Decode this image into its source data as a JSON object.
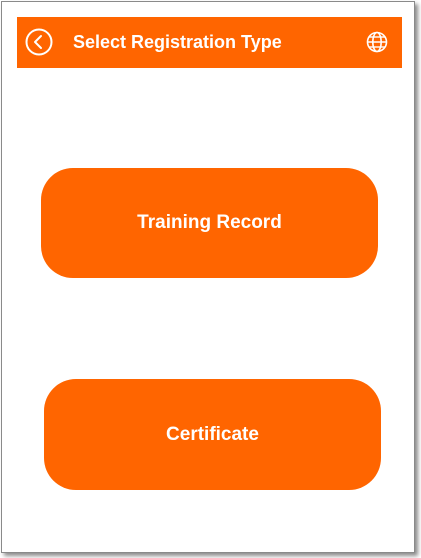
{
  "header": {
    "title": "Select Registration Type",
    "back_icon": "chevron-left-circle-icon",
    "language_icon": "globe-icon"
  },
  "buttons": {
    "training_record": "Training Record",
    "certificate": "Certificate"
  },
  "colors": {
    "accent": "#ff6500",
    "text_on_accent": "#ffffff",
    "background": "#ffffff"
  }
}
